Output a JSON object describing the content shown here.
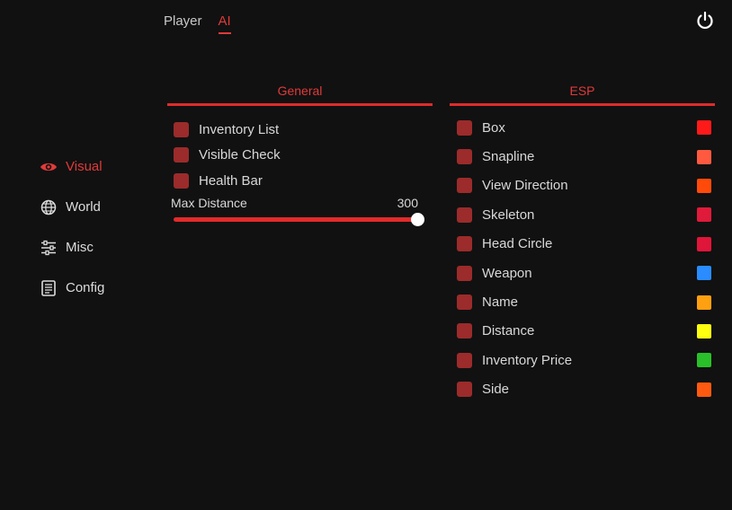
{
  "tabs": [
    {
      "label": "Player",
      "active": false
    },
    {
      "label": "AI",
      "active": true
    }
  ],
  "power_icon": "power-icon",
  "sidebar": {
    "items": [
      {
        "label": "Visual",
        "icon": "eye-icon",
        "active": true
      },
      {
        "label": "World",
        "icon": "globe-icon",
        "active": false
      },
      {
        "label": "Misc",
        "icon": "sliders-icon",
        "active": false
      },
      {
        "label": "Config",
        "icon": "document-icon",
        "active": false
      }
    ]
  },
  "general": {
    "title": "General",
    "checks": [
      {
        "label": "Inventory List"
      },
      {
        "label": "Visible Check"
      },
      {
        "label": "Health Bar"
      }
    ],
    "slider": {
      "label": "Max Distance",
      "value": "300",
      "fill": 1.0
    }
  },
  "esp": {
    "title": "ESP",
    "items": [
      {
        "label": "Box",
        "color": "#ff1a1a"
      },
      {
        "label": "Snapline",
        "color": "#ff5a40"
      },
      {
        "label": "View Direction",
        "color": "#ff4a0a"
      },
      {
        "label": "Skeleton",
        "color": "#e01a3a"
      },
      {
        "label": "Head Circle",
        "color": "#e0153a"
      },
      {
        "label": "Weapon",
        "color": "#2a8cff"
      },
      {
        "label": "Name",
        "color": "#ffa010"
      },
      {
        "label": "Distance",
        "color": "#ffff10"
      },
      {
        "label": "Inventory Price",
        "color": "#2ac02a"
      },
      {
        "label": "Side",
        "color": "#ff5a10"
      }
    ]
  },
  "colors": {
    "accent": "#e03a3a",
    "checkbox": "#9c2b2b",
    "background": "#111111"
  }
}
